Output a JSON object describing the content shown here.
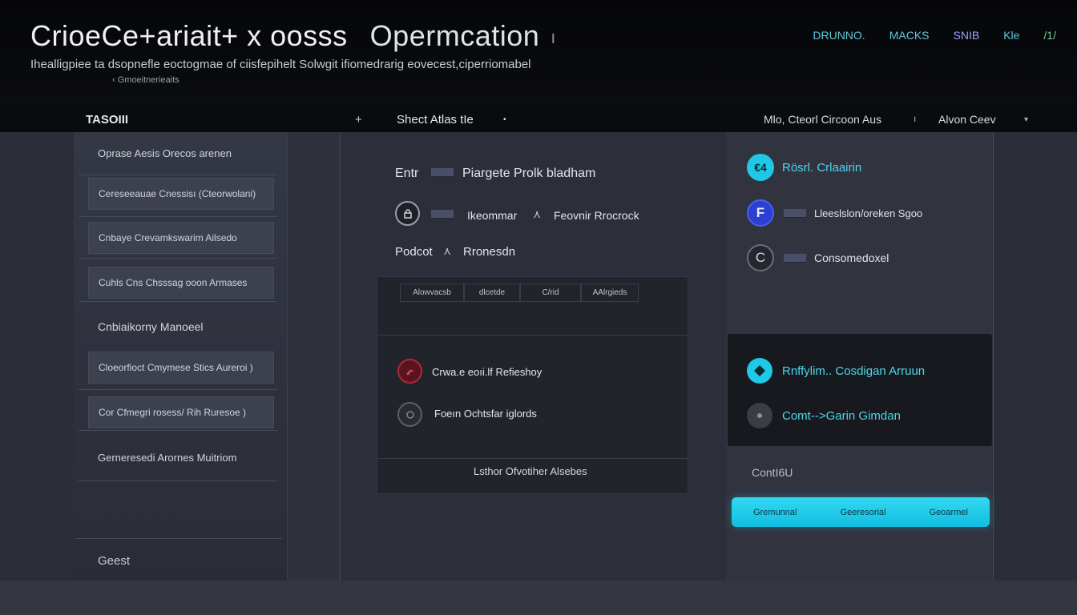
{
  "colors": {
    "accent_cyan": "#1ec8e6",
    "nav_teal": "#5fc9d9",
    "nav_purple": "#9aa3ff",
    "nav_green": "#6fd39a",
    "brand_red": "#b0263a",
    "brand_blue": "#2b3fd0"
  },
  "header": {
    "title_a": "CrioeCe+ariait+ x oosss",
    "title_b": "Opermcation",
    "title_c": "ı",
    "subtitle": "Ihealligpiee ta dsopnefle eoctogmae of ciisfepihelt Solwgit ifiomedrarig eovecest,ciperriomabel",
    "subnote": "‹ Gmoeitnerieaits",
    "nav": [
      "DRUNNO.",
      "MACKS",
      "SNIB",
      "Kle",
      "/1/"
    ]
  },
  "toolbar": {
    "left_label": "TASOIII",
    "add_symbol": "+",
    "center_label": "Shect Atlas tIe",
    "center_dot": "•",
    "right_label": "Mlo, Cteorl Circoon Aus",
    "right_sep": "ı",
    "dropdown_label": "Alvon Ceev",
    "dropdown_caret": "▾"
  },
  "sidebar": {
    "items": [
      {
        "label": "Oprase Aesis Orecos arenen",
        "style": "plain"
      },
      {
        "label": "Cereseeauae Cnessisı (Cteorwolani)",
        "style": "boxed"
      },
      {
        "label": "Cnbaye Crevamkswarim Ailsedo",
        "style": "boxed"
      },
      {
        "label": "Cuhls Cns Chsssag ooon Armases",
        "style": "boxed"
      },
      {
        "label": "Cnbiaikorny Manoeel",
        "style": "plain"
      },
      {
        "label": "Cloeorfioct Cmymese Stics Aureroi )",
        "style": "boxed"
      },
      {
        "label": "Cor Cfmegri rosess/ Rih Ruresoe )",
        "style": "boxed"
      },
      {
        "label": "Gerneresedi Arornes Muitriom",
        "style": "plain"
      }
    ],
    "footer_label": "Geest"
  },
  "main": {
    "row1_label": "Entr",
    "row1_text": "Piargete Prolk bladham",
    "row2_text_a": "Ikeommar",
    "row2_text_b": "Feovnir Rrocrock",
    "row2_arrow": "⋏",
    "row3_label": "Podcot",
    "row3_arrow": "⋏",
    "row3_text": "Rronesdn",
    "tabs": [
      "Alowvacsb",
      "dlcetde",
      "C/rid",
      "AAlrgieds"
    ],
    "list": [
      {
        "label": "Crwa.e eoıi.lf Refieshoy",
        "icon": "red-emblem-icon"
      },
      {
        "label": "Foeın Ochtsfar iglords",
        "icon": "gray-circle-icon"
      }
    ],
    "panel_footer": "Lsthor Ofvotiher Alsebes"
  },
  "right": {
    "items": [
      {
        "label": "Rösrl. Crlaairin",
        "letter": "€4"
      },
      {
        "label": "Lleeslslon/oreken Sgoo",
        "letter": "F"
      },
      {
        "label": "Consomedoxel",
        "letter": "C"
      }
    ],
    "card_items": [
      {
        "label": "Rnffylim.. Cosdigan Arruun"
      },
      {
        "label": "Comt-->Garin Gimdan"
      }
    ],
    "section_label": "ContI6U",
    "bar_labels": [
      "Gremunnal",
      "Geeresorial",
      "Geoarmel"
    ]
  }
}
